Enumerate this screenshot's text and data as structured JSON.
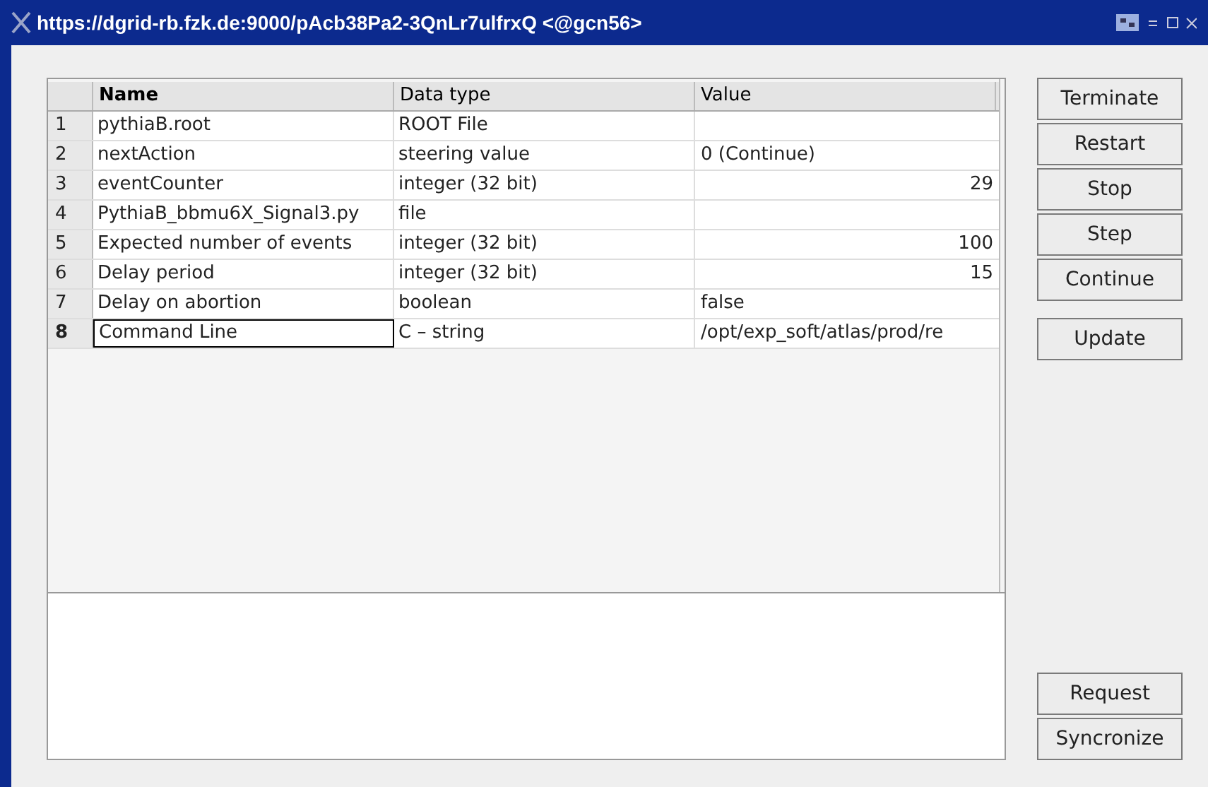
{
  "window": {
    "title": "https://dgrid-rb.fzk.de:9000/pAcb38Pa2-3QnLr7ulfrxQ <@gcn56>"
  },
  "table": {
    "columns": [
      "Name",
      "Data type",
      "Value"
    ],
    "rows": [
      {
        "number": "1",
        "name": "pythiaB.root",
        "type": "ROOT File",
        "selected": false
      },
      {
        "number": "2",
        "name": "nextAction",
        "type": "steering value",
        "value": "0 (Continue)",
        "kind": "text",
        "selected": false
      },
      {
        "number": "3",
        "name": "eventCounter",
        "type": "integer (32 bit)",
        "value": "29",
        "kind": "number",
        "selected": false
      },
      {
        "number": "4",
        "name": "PythiaB_bbmu6X_Signal3.py",
        "type": "file",
        "selected": false
      },
      {
        "number": "5",
        "name": "Expected number of events",
        "type": "integer (32 bit)",
        "value": "100",
        "kind": "number",
        "selected": false
      },
      {
        "number": "6",
        "name": "Delay period",
        "type": "integer (32 bit)",
        "value": "15",
        "kind": "number",
        "selected": false
      },
      {
        "number": "7",
        "name": "Delay on abortion",
        "type": "boolean",
        "value": "false",
        "kind": "text",
        "selected": false
      },
      {
        "number": "8",
        "name": "Command Line",
        "type": "C – string",
        "value": "/opt/exp_soft/atlas/prod/re",
        "kind": "text",
        "selected": true
      }
    ]
  },
  "control_buttons": [
    "Terminate",
    "Restart",
    "Stop",
    "Step",
    "Continue"
  ],
  "update_button": "Update",
  "bottom_buttons": [
    "Request",
    "Syncronize"
  ]
}
